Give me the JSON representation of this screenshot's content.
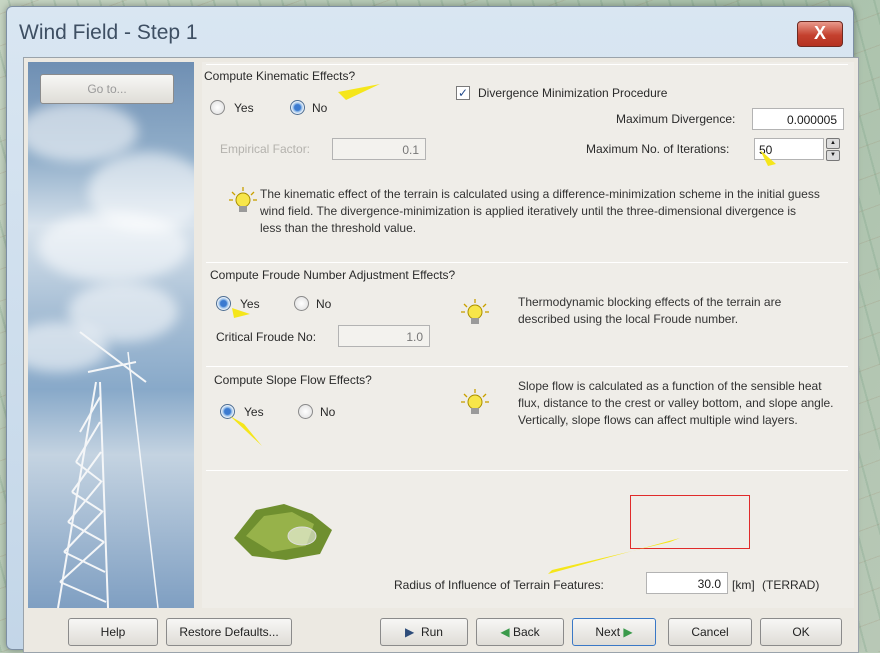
{
  "window": {
    "title": "Wind Field - Step 1",
    "close_glyph": "X"
  },
  "nav": {
    "goto_label": "Go to..."
  },
  "kinematic": {
    "group_label": "Compute Kinematic Effects?",
    "yes_label": "Yes",
    "no_label": "No",
    "selected": "No",
    "empirical_factor_label": "Empirical Factor:",
    "empirical_factor_value": "0.1",
    "divergence_checkbox_label": "Divergence Minimization Procedure",
    "divergence_checked": true,
    "max_divergence_label": "Maximum Divergence:",
    "max_divergence_value": "0.000005",
    "max_iterations_label": "Maximum  No. of Iterations:",
    "max_iterations_value": "50",
    "info": "The kinematic effect of the terrain is calculated using a difference-minimization scheme in the initial guess wind field. The divergence-minimization is applied iteratively until the three-dimensional divergence is less than the threshold value."
  },
  "froude": {
    "group_label": "Compute Froude Number Adjustment Effects?",
    "yes_label": "Yes",
    "no_label": "No",
    "selected": "Yes",
    "critical_label": "Critical Froude No:",
    "critical_value": "1.0",
    "info": "Thermodynamic blocking effects of the terrain are described using the local Froude number."
  },
  "slope": {
    "group_label": "Compute Slope Flow Effects?",
    "yes_label": "Yes",
    "no_label": "No",
    "selected": "Yes",
    "info": "Slope flow is calculated as a function of the sensible heat flux, distance to the crest or valley bottom, and slope angle. Vertically, slope flows can affect multiple wind layers."
  },
  "terrain": {
    "radius_label": "Radius of Influence of Terrain Features:",
    "radius_value": "30.0",
    "unit": "[km]",
    "param": "(TERRAD)"
  },
  "buttons": {
    "help": "Help",
    "restore": "Restore Defaults...",
    "run": "Run",
    "back": "Back",
    "next": "Next",
    "cancel": "Cancel",
    "ok": "OK"
  },
  "colors": {
    "annotation_arrow": "#f5e61a",
    "annotation_box": "#e02b2b",
    "close_button": "#c4412f"
  }
}
